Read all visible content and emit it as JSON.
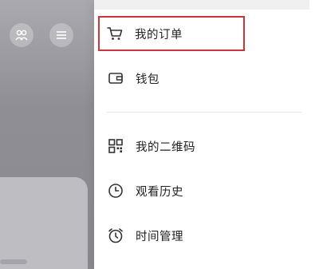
{
  "colors": {
    "highlight_border": "#c9373a",
    "backdrop": "#8e8e94",
    "text": "#222222",
    "icon": "#333333"
  },
  "backdrop": {
    "buttons": [
      {
        "icon": "friends-icon"
      },
      {
        "icon": "menu-icon"
      }
    ]
  },
  "drawer": {
    "items": [
      {
        "label": "我的订单",
        "icon": "cart-icon",
        "highlighted": true
      },
      {
        "label": "钱包",
        "icon": "wallet-icon",
        "highlighted": false
      },
      {
        "label": "我的二维码",
        "icon": "qrcode-icon",
        "highlighted": false
      },
      {
        "label": "观看历史",
        "icon": "clock-icon",
        "highlighted": false
      },
      {
        "label": "时间管理",
        "icon": "alarm-clock-icon",
        "highlighted": false
      }
    ]
  }
}
